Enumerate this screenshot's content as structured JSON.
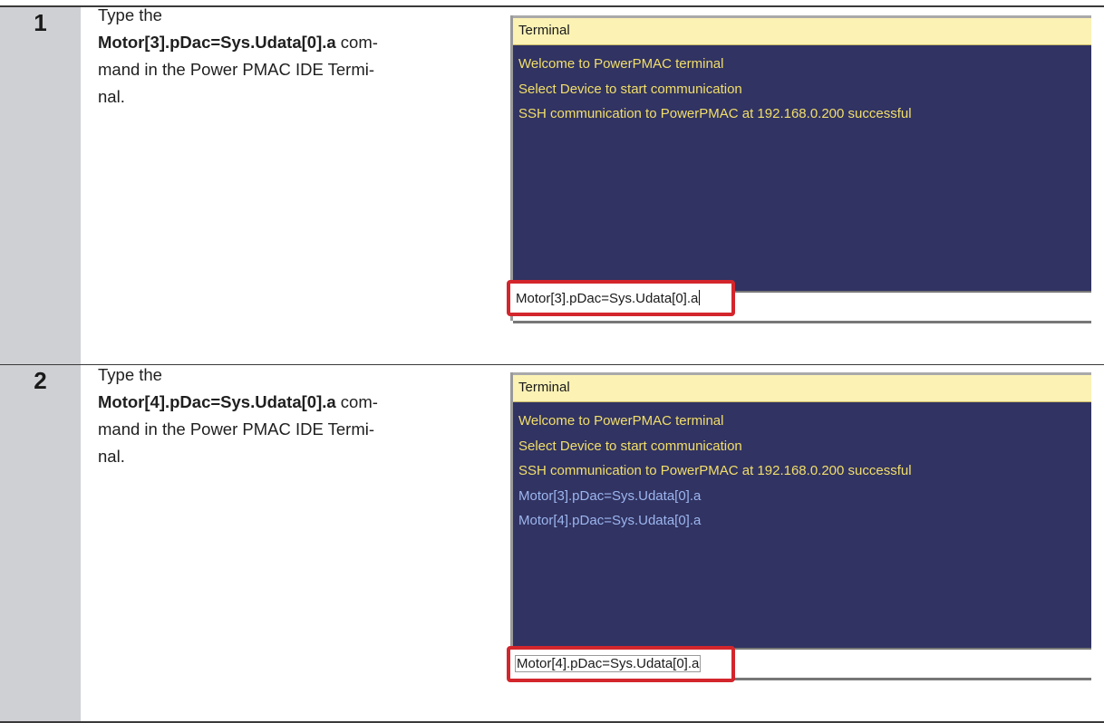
{
  "steps": [
    {
      "number": "1",
      "desc": {
        "line1": "Type the",
        "bold": "Motor[3].pDac=Sys.Udata[0].a",
        "tail1": " com-",
        "line3": "mand in the Power PMAC IDE Termi-",
        "line4": "nal."
      },
      "terminal": {
        "title": "Terminal",
        "welcome_lines": [
          "Welcome to PowerPMAC terminal",
          "Select Device to start communication",
          "SSH communication to PowerPMAC at 192.168.0.200 successful"
        ],
        "echo_lines": [],
        "input_value": "Motor[3].pDac=Sys.Udata[0].a"
      }
    },
    {
      "number": "2",
      "desc": {
        "line1": "Type the",
        "bold": "Motor[4].pDac=Sys.Udata[0].a",
        "tail1": " com-",
        "line3": "mand in the Power PMAC IDE Termi-",
        "line4": "nal."
      },
      "terminal": {
        "title": "Terminal",
        "welcome_lines": [
          "Welcome to PowerPMAC terminal",
          "Select Device to start communication",
          "SSH communication to PowerPMAC at 192.168.0.200 successful"
        ],
        "echo_lines": [
          "Motor[3].pDac=Sys.Udata[0].a",
          "Motor[4].pDac=Sys.Udata[0].a"
        ],
        "input_value": "Motor[4].pDac=Sys.Udata[0].a"
      }
    }
  ],
  "colors": {
    "terminal_bg": "#313362",
    "terminal_header": "#fbf2b4",
    "welcome_text": "#f2df6a",
    "echo_text": "#9cb6ef",
    "highlight_border": "#d3262c",
    "step_number_bg": "#cfd0d4"
  }
}
